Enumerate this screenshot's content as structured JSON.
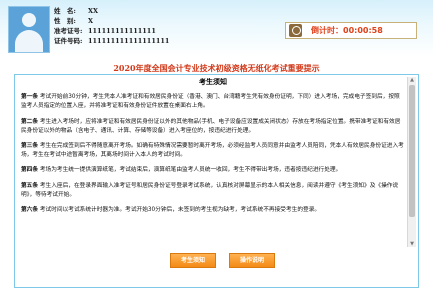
{
  "candidate": {
    "name_label": "姓　名:",
    "name_value": "XX",
    "gender_label": "性　别:",
    "gender_value": "X",
    "ticket_label": "准考证号:",
    "ticket_value": "111111111111111",
    "id_label": "证件号码:",
    "id_value": "111111111111111111"
  },
  "timer": {
    "text": "倒计时：00:00:58"
  },
  "page_title": "2020年度全国会计专业技术初级资格无纸化考试重要提示",
  "notice": {
    "heading": "考生须知",
    "paragraphs": [
      {
        "num": "第一条",
        "text": "考试开始前30分钟，考生凭本人准考证和有效居民身份证（香港、澳门、台湾籍考生凭有效身份证明，下同）进入考场，完成电子签到后，按照监考人员指定的位置入座，并将准考证和有效身份证件放置在桌面右上角。"
      },
      {
        "num": "第二条",
        "text": "考生进入考场时，应将准考证和有效居民身份证以外的其他物品(手机、电子设备应设置成关闭状态）存放在考场指定位置。携带准考证和有效居民身份证以外的物品（含电子、通讯、计算、存储等设备）进入考座位的，按违纪进行处理。"
      },
      {
        "num": "第三条",
        "text": "考生在完成签到后不得随意离开考场。如确有特殊情况需要暂时离开考场，必须经监考人员同意并由监考人员陪同，凭本人有效居民身份证进入考场，考生在考试中途暂离考场，其离场时间计入本人的考试时间。"
      },
      {
        "num": "第四条",
        "text": "考场为考生统一提供演算纸笔，考试结束后，演算纸笔由监考人员统一收回，考生不得带出考场，违者按违纪进行处理。"
      },
      {
        "num": "第五条",
        "text": "考生入座后，在登录界面输入准考证号和居民身份证号登录考试系统，认真核对屏幕显示的本人相关信息，阅读并遵守《考生须知》及《操作说明》，等待考试开始。"
      },
      {
        "num": "第六条",
        "text": "考试时间以考试系统计时器为准。考试开始30分钟后，未签到的考生视为缺考，考试系统不再接受考生的登录。"
      }
    ]
  },
  "buttons": {
    "notice_label": "考生须知",
    "operation_label": "操作说明"
  }
}
